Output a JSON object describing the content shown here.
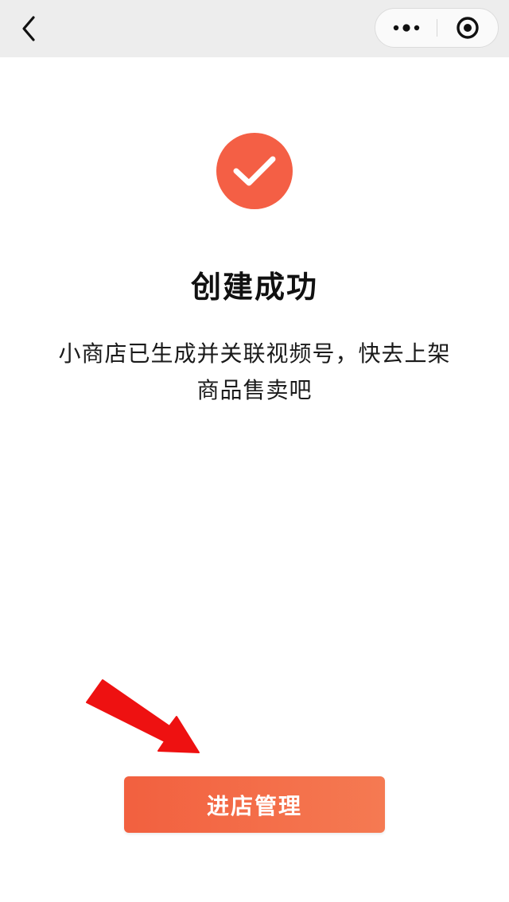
{
  "header": {
    "back_icon": "chevron-left-icon",
    "more_icon": "more-dots-icon",
    "close_icon": "target-circle-icon"
  },
  "main": {
    "status_icon": "check-icon",
    "title": "创建成功",
    "description_line1": "小商店已生成并关联视频号，快去上架",
    "description_line2": "商品售卖吧"
  },
  "footer": {
    "primary_button_label": "进店管理"
  },
  "colors": {
    "accent": "#f45f45",
    "button_start": "#f2603f",
    "button_end": "#f57a52",
    "annotation_arrow": "#ee1111",
    "top_bar_bg": "#ededed"
  }
}
